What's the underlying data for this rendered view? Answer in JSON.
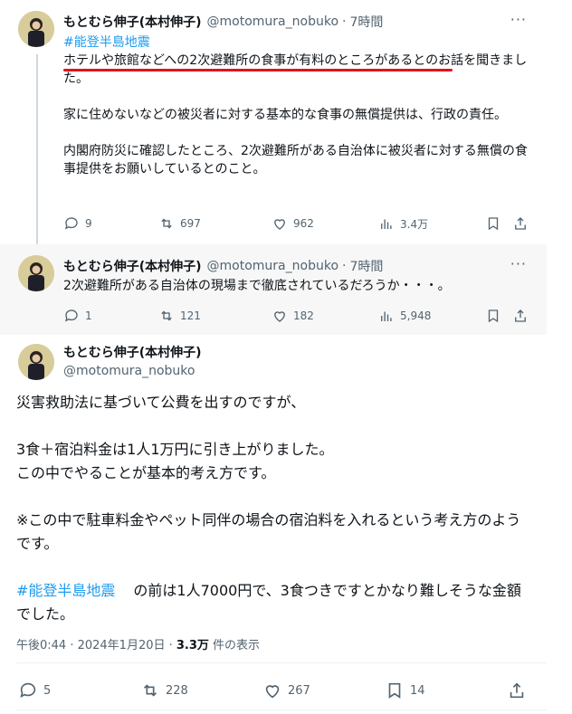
{
  "tweets": [
    {
      "name": "もとむら伸子(本村伸子)",
      "handle": "@motomura_nobuko",
      "time": "7時間",
      "hashtag": "#能登半島地震",
      "paragraphs": [
        "ホテルや旅館などへの2次避難所の食事が有料のところがあるとのお話を聞きました。",
        "家に住めないなどの被災者に対する基本的な食事の無償提供は、行政の責任。",
        "内閣府防災に確認したところ、2次避難所がある自治体に被災者に対する無償の食事提供をお願いしているとのこと。"
      ],
      "stats": {
        "replies": "9",
        "reposts": "697",
        "likes": "962",
        "views": "3.4万"
      }
    },
    {
      "name": "もとむら伸子(本村伸子)",
      "handle": "@motomura_nobuko",
      "time": "7時間",
      "text": "2次避難所がある自治体の現場まで徹底されているだろうか・・・。",
      "stats": {
        "replies": "1",
        "reposts": "121",
        "likes": "182",
        "views": "5,948"
      }
    },
    {
      "name": "もとむら伸子(本村伸子)",
      "handle": "@motomura_nobuko",
      "paragraphs": [
        "災害救助法に基づいて公費を出すのですが、",
        "3食＋宿泊料金は1人1万円に引き上がりました。",
        "この中でやることが基本的考え方です。",
        "※この中で駐車料金やペット同伴の場合の宿泊料を入れるという考え方のようです。"
      ],
      "hashtag": "#能登半島地震",
      "last_text": "の前は1人7000円で、3食つきですとかなり難しそうな金額でした。",
      "meta_time": "午後0:44 · 2024年1月20日 · ",
      "meta_views": "3.3万",
      "meta_views_label": " 件の表示",
      "stats": {
        "replies": "5",
        "reposts": "228",
        "likes": "267",
        "bookmarks": "14"
      }
    }
  ],
  "separator_dot": "·",
  "more_label": "···",
  "colors": {
    "hashtag": "#1d9bf0",
    "underline": "#e0141e",
    "secondary": "#536471"
  },
  "icons": [
    "reply-icon",
    "repost-icon",
    "like-icon",
    "views-icon",
    "bookmark-icon",
    "share-icon",
    "more-icon"
  ]
}
